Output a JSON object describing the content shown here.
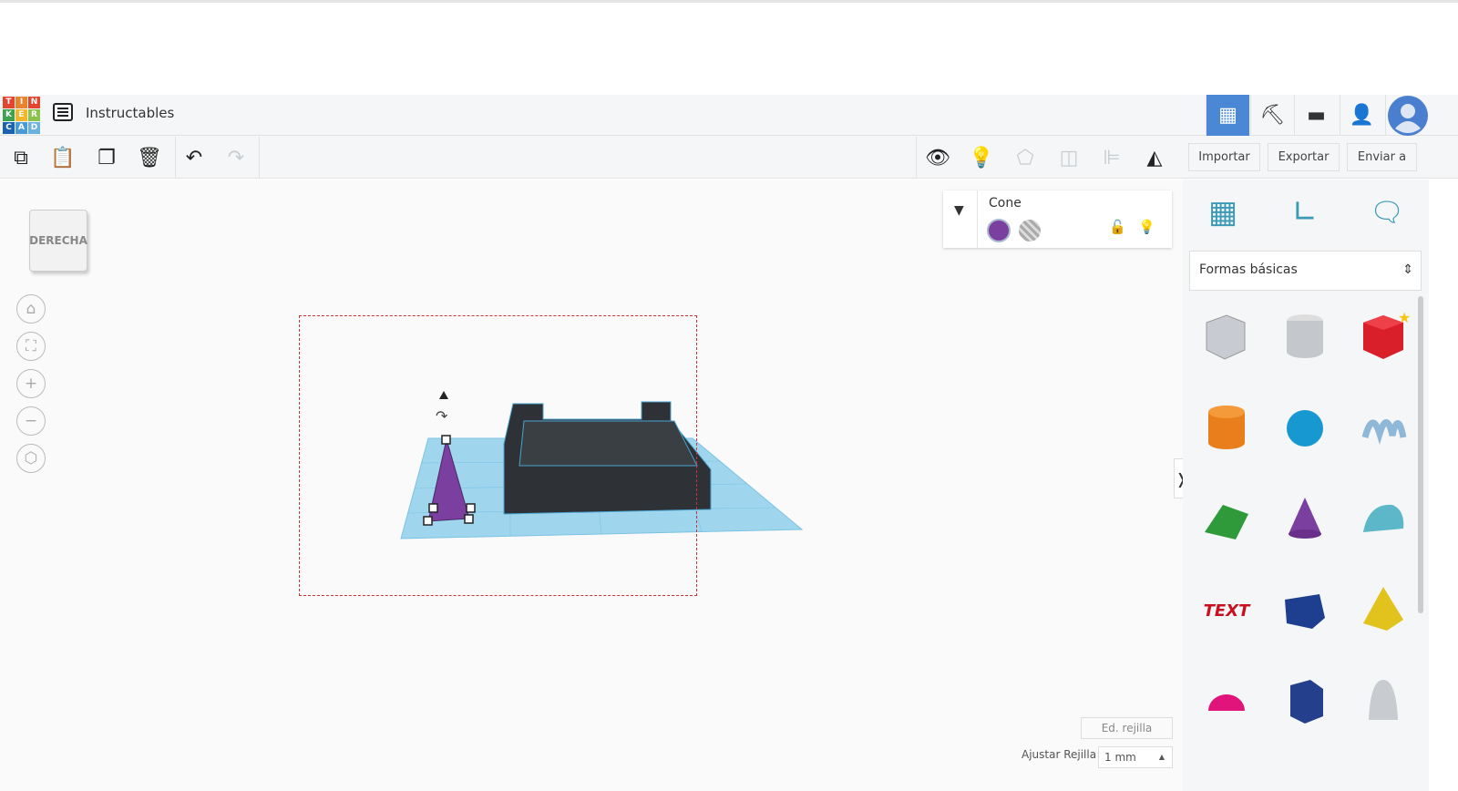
{
  "header": {
    "title": "Instructables",
    "logo_letters": [
      "T",
      "I",
      "N",
      "K",
      "E",
      "R",
      "C",
      "A",
      "D"
    ]
  },
  "toolbar": {
    "import": "Importar",
    "export": "Exportar",
    "send": "Enviar a"
  },
  "viewcube": {
    "label": "DERECHA"
  },
  "inspector": {
    "shape_name": "Cone",
    "color": "#7b3fa0"
  },
  "panel": {
    "category": "Formas básicas"
  },
  "grid": {
    "edit": "Ed. rejilla",
    "snap_label": "Ajustar Rejilla",
    "snap_value": "1 mm"
  },
  "shapes": [
    "box-hole",
    "cylinder-hole",
    "box",
    "cylinder",
    "sphere",
    "scribble",
    "roof",
    "cone",
    "round-roof",
    "text",
    "polygon",
    "pyramid",
    "half-sphere",
    "hexagonal-prism",
    "paraboloid"
  ],
  "text_shape_label": "TEXT"
}
